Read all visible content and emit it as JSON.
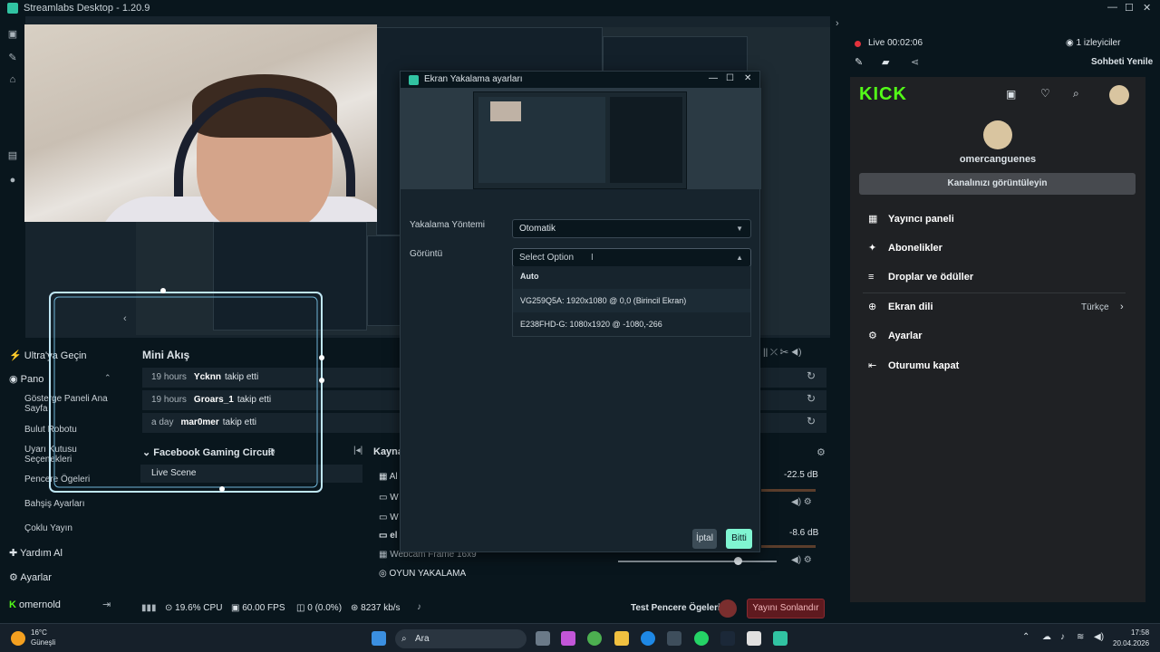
{
  "window": {
    "title": "Streamlabs Desktop - 1.20.9"
  },
  "nav": {
    "ultra": "Ultra'ya Geçin",
    "pano": "Pano",
    "sub_items": [
      "Gösterge Paneli Ana Sayfa",
      "Bulut Robotu",
      "Uyarı Kutusu Seçenekleri",
      "Pencere Ögeleri",
      "Bahşiş Ayarları",
      "Çoklu Yayın"
    ],
    "help": "Yardım Al",
    "settings": "Ayarlar",
    "user": "omernold"
  },
  "mini_feed": {
    "title": "Mini Akış",
    "rows": [
      {
        "time": "19 hours",
        "name": "Ycknn",
        "action": "takip etti"
      },
      {
        "time": "19 hours",
        "name": "Groars_1",
        "action": "takip etti"
      },
      {
        "time": "a day",
        "name": "mar0mer",
        "action": "takip etti"
      }
    ]
  },
  "scenes": {
    "title": "Facebook Gaming Circuit",
    "items": [
      "Live Scene"
    ]
  },
  "sources": {
    "title": "Kayna",
    "items": [
      "Al",
      "W",
      "W",
      "el",
      "Webcam Frame 16x9",
      "OYUN YAKALAMA"
    ]
  },
  "mixer": {
    "levels": [
      "-22.5 dB",
      "-8.6 dB"
    ]
  },
  "footer": {
    "cpu": "19.6% CPU",
    "fps": "60.00 FPS",
    "dropped": "0 (0.0%)",
    "bitrate": "8237 kb/s",
    "test_label": "Test Pencere Ögeleri",
    "end_stream": "Yayını Sonlandır"
  },
  "dialog": {
    "title": "Ekran Yakalama ayarları",
    "method_label": "Yakalama Yöntemi",
    "method_value": "Otomatik",
    "display_label": "Görüntü",
    "display_value": "Select Option",
    "options": [
      "Auto",
      "VG259Q5A: 1920x1080 @ 0,0 (Birincil Ekran)",
      "E238FHD-G: 1080x1920 @ -1080,-266"
    ],
    "cancel": "İptal",
    "done": "Bitti"
  },
  "stream_status": {
    "live": "Live 00:02:06",
    "viewers": "1 izleyiciler",
    "refresh_chat": "Sohbeti Yenile"
  },
  "kick": {
    "logo": "KICK",
    "username": "omercanguenes",
    "view_channel": "Kanalınızı görüntüleyin",
    "menu": [
      "Yayıncı paneli",
      "Abonelikler",
      "Droplar ve ödüller",
      "Ekran dili",
      "Ayarlar",
      "Oturumu kapat"
    ],
    "language_value": "Türkçe"
  },
  "taskbar": {
    "weather_temp": "16°C",
    "weather_desc": "Güneşli",
    "search": "Ara",
    "time": "17:58",
    "date": "20.04.2026"
  },
  "colors": {
    "accent": "#31c3a2",
    "kick_green": "#53fc18",
    "live_red": "#e3323c"
  }
}
